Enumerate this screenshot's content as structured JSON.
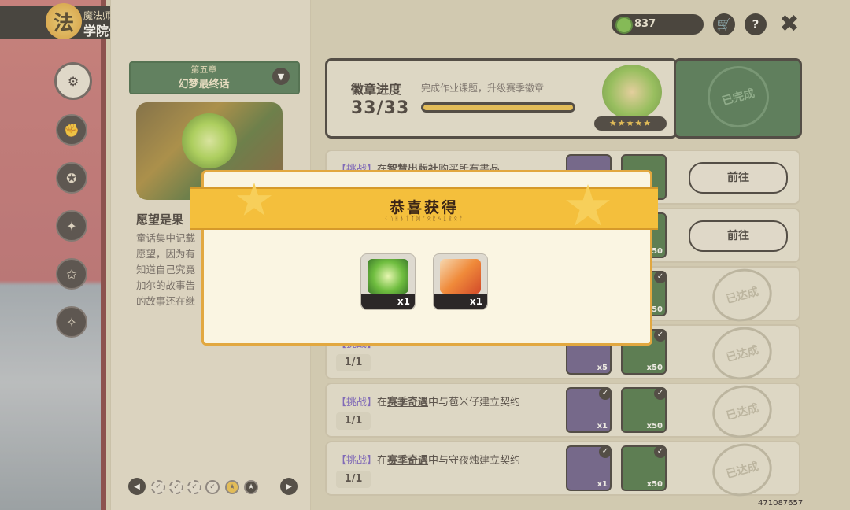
{
  "header": {
    "logo_glyph": "法",
    "subtitle": "魔法师手册",
    "title": "学院作业"
  },
  "nav": {
    "items": [
      {
        "name": "handbook-icon",
        "glyph": "⚙"
      },
      {
        "name": "scroll-icon",
        "glyph": "✊"
      },
      {
        "name": "star-badge-icon",
        "glyph": "✪"
      },
      {
        "name": "magic-circle-icon",
        "glyph": "✦"
      },
      {
        "name": "pentagon-star-icon",
        "glyph": "✩"
      },
      {
        "name": "shield-crest-icon",
        "glyph": "✧"
      }
    ]
  },
  "chapter": {
    "number": "第五章",
    "name": "幻梦最终话",
    "dropdown_glyph": "▼"
  },
  "story": {
    "title": "愿望是果",
    "lines": [
      "童话集中记载",
      "愿望，因为有",
      "知道自己究竟",
      "加尔的故事告",
      "的故事还在继"
    ]
  },
  "pager": {
    "prev": "◀",
    "next": "▶",
    "dots": [
      "✓",
      "✓",
      "✓",
      "✓",
      "★",
      "★"
    ],
    "current_index": 4
  },
  "currency": {
    "value": "837",
    "color": "#6fbd3f"
  },
  "top_buttons": {
    "cart": "🛒",
    "help": "?",
    "close": "✖"
  },
  "badge": {
    "title": "徽章进度",
    "desc": "完成作业课题，升级赛季徽章",
    "count": "33/33",
    "progress": 1.0,
    "stars": "★★★★★",
    "done_stamp": "已完成"
  },
  "tasks": [
    {
      "tag": "【挑战】",
      "pre": "在",
      "link": "智慧出版社",
      "post": "购买所有書品",
      "progress": "",
      "status": "go",
      "button": "前往",
      "rewards": [
        {
          "qty": "",
          "color": "purple",
          "checked": false
        },
        {
          "qty": "",
          "color": "green",
          "checked": false
        }
      ]
    },
    {
      "tag": "",
      "pre": "",
      "link": "",
      "post": "",
      "progress": "",
      "status": "go",
      "button": "前往",
      "rewards": [
        {
          "qty": "",
          "color": "purple",
          "checked": false
        },
        {
          "qty": "x50",
          "color": "green",
          "checked": false
        }
      ]
    },
    {
      "tag": "",
      "pre": "",
      "link": "",
      "post": "",
      "progress": "",
      "status": "done",
      "button": "已达成",
      "rewards": [
        {
          "qty": "",
          "color": "purple",
          "checked": true
        },
        {
          "qty": "x50",
          "color": "green",
          "checked": true
        }
      ]
    },
    {
      "tag": "【挑战】",
      "pre": "",
      "link": "",
      "post": "",
      "progress": "1/1",
      "status": "done",
      "button": "已达成",
      "rewards": [
        {
          "qty": "x5",
          "color": "purple",
          "checked": true
        },
        {
          "qty": "x50",
          "color": "green",
          "checked": true
        }
      ]
    },
    {
      "tag": "【挑战】",
      "pre": "在",
      "link": "赛季奇遇",
      "post": "中与苞米仔建立契约",
      "progress": "1/1",
      "status": "done",
      "button": "已达成",
      "rewards": [
        {
          "qty": "x1",
          "color": "purple",
          "checked": true
        },
        {
          "qty": "x50",
          "color": "green",
          "checked": true
        }
      ]
    },
    {
      "tag": "【挑战】",
      "pre": "在",
      "link": "赛季奇遇",
      "post": "中与守夜烛建立契约",
      "progress": "1/1",
      "status": "done",
      "button": "已达成",
      "rewards": [
        {
          "qty": "x1",
          "color": "purple",
          "checked": true
        },
        {
          "qty": "x50",
          "color": "green",
          "checked": true
        }
      ]
    }
  ],
  "modal": {
    "title": "恭喜获得",
    "runes": "ᚲᚢᚺᚾᛏᛉᛞᚠᛟᚱᛃᛈᚱᛟᚨ",
    "items": [
      {
        "name": "clover-card-item",
        "qty": "x1"
      },
      {
        "name": "gift-box-item",
        "qty": "x1"
      }
    ]
  },
  "build_id": "471087657"
}
